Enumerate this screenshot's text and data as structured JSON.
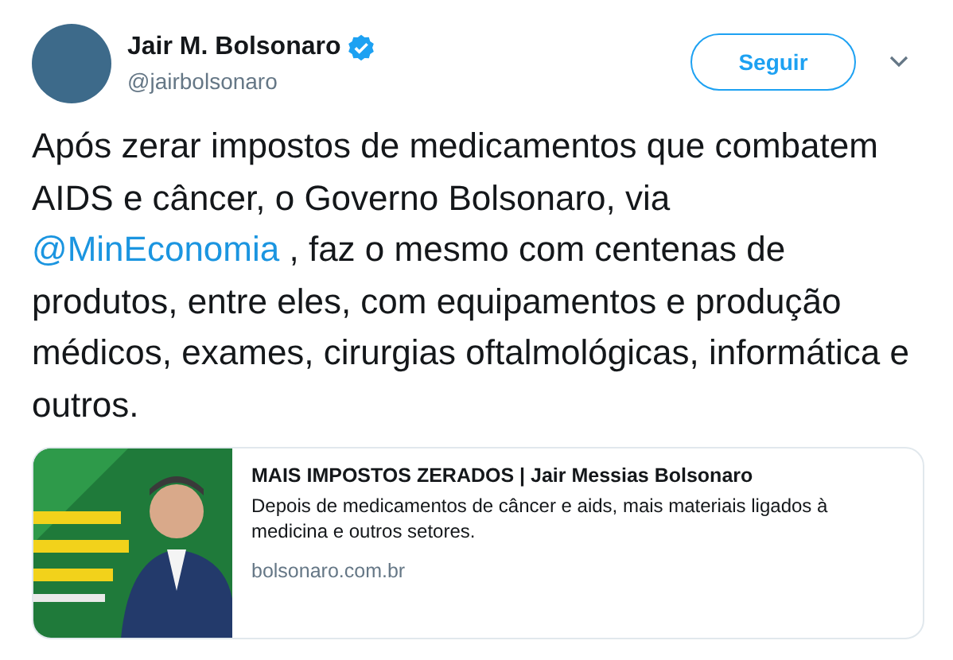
{
  "tweet": {
    "author": {
      "name": "Jair M. Bolsonaro",
      "verified": true,
      "handle": "@jairbolsonaro"
    },
    "follow_button": "Seguir",
    "text": [
      {
        "kind": "text",
        "text": "Após zerar impostos de medicamentos que combatem AIDS e câncer, o Governo Bolsonaro, via "
      },
      {
        "kind": "mention",
        "text": "@MinEconomia"
      },
      {
        "kind": "text",
        "text": " , faz o mesmo com centenas de produtos, entre eles, com equipamentos e produção médicos, exames, cirurgias oftalmológicas, informática e outros."
      }
    ],
    "card": {
      "kind": "picture",
      "title": "MAIS IMPOSTOS ZERADOS | Jair Messias Bolsonaro",
      "description": "Depois de medicamentos de câncer e aids, mais materiais ligados à medicina e outros setores.",
      "domain": "bolsonaro.com.br"
    }
  }
}
